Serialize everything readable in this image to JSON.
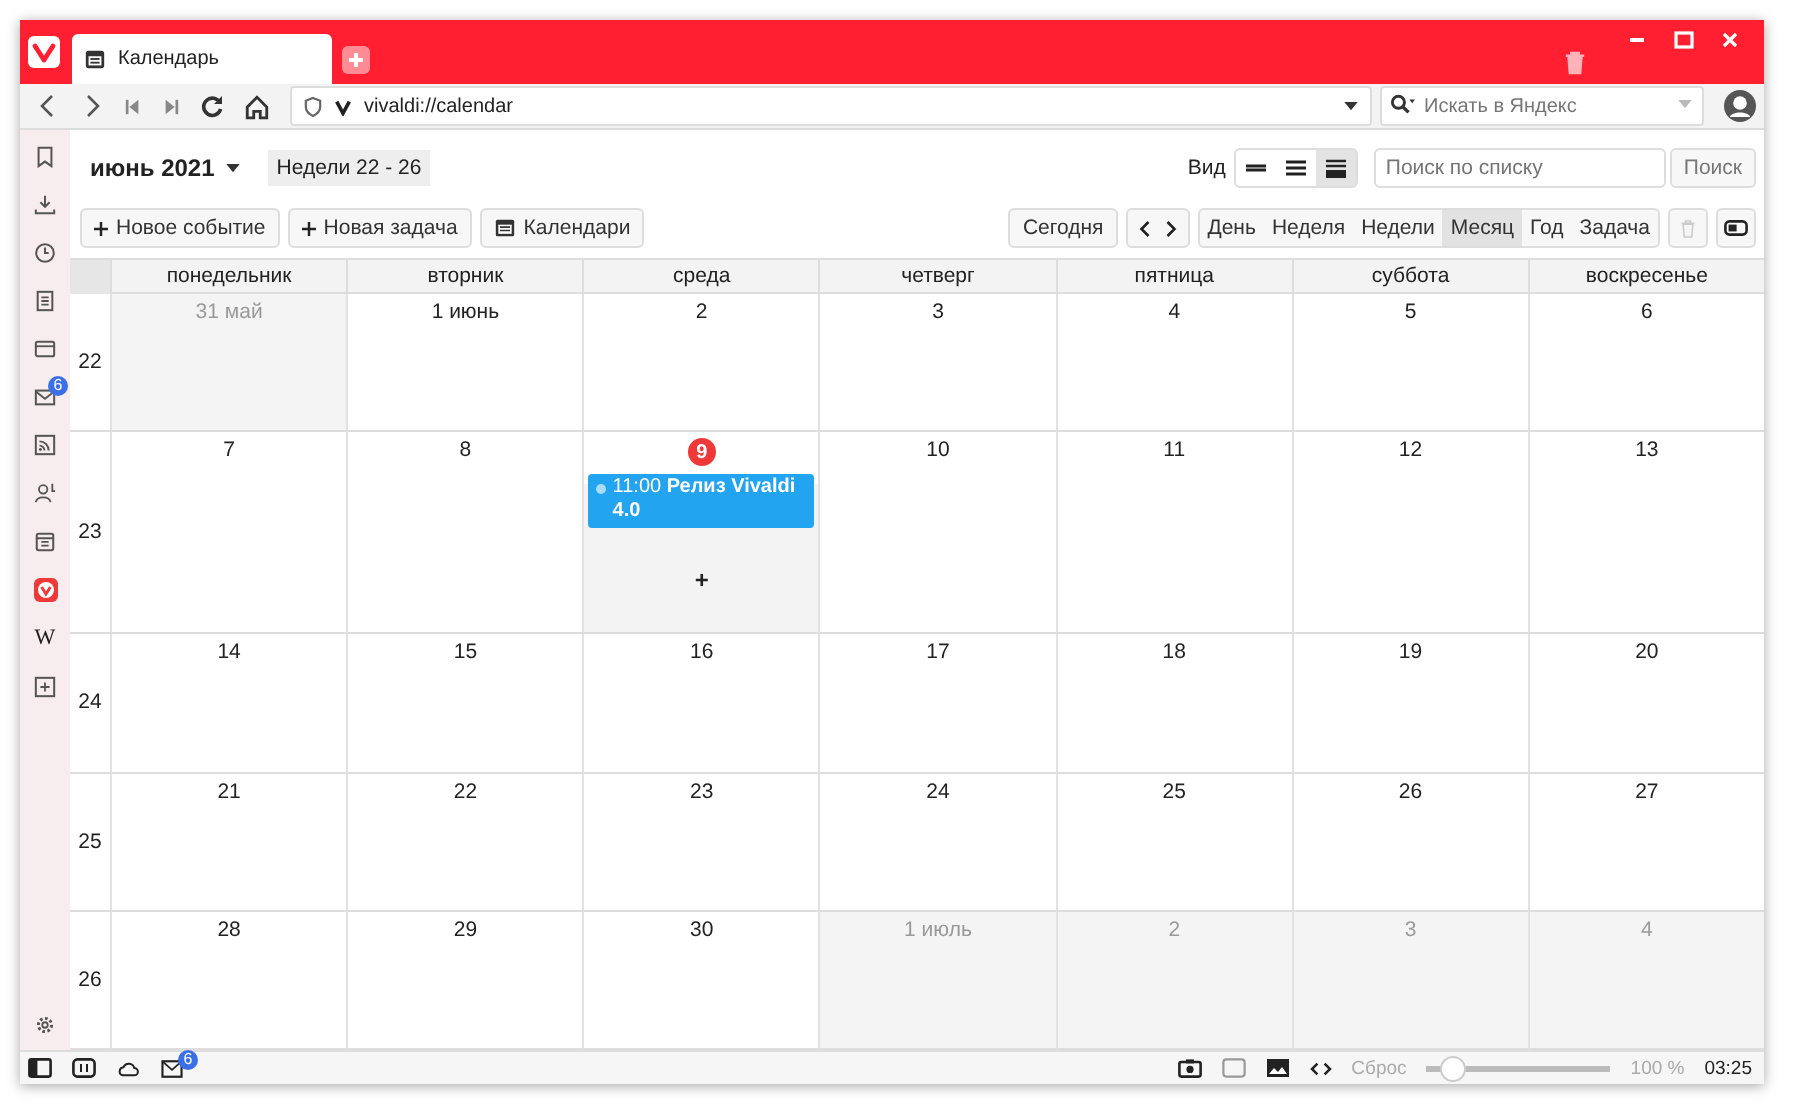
{
  "tab": {
    "title": "Календарь"
  },
  "address": {
    "url": "vivaldi://calendar",
    "search_placeholder": "Искать в Яндекс"
  },
  "sidebar": {
    "mail_badge": "6",
    "web_panel": "W"
  },
  "toolbar": {
    "period": "июнь 2021",
    "weeks": "Недели 22 - 26",
    "view_label": "Вид",
    "view_modes": [
      {
        "selected": false
      },
      {
        "selected": false
      },
      {
        "selected": true
      }
    ],
    "list_search_placeholder": "Поиск по списку",
    "search_button": "Поиск",
    "actions": [
      {
        "kind": "plus",
        "label": "Новое событие"
      },
      {
        "kind": "plus",
        "label": "Новая задача"
      },
      {
        "kind": "calendar",
        "label": "Календари"
      }
    ],
    "today_button": "Сегодня",
    "ranges": [
      {
        "label": "День",
        "selected": false
      },
      {
        "label": "Неделя",
        "selected": false
      },
      {
        "label": "Недели",
        "selected": false
      },
      {
        "label": "Месяц",
        "selected": true
      },
      {
        "label": "Год",
        "selected": false
      },
      {
        "label": "Задача",
        "selected": false
      }
    ]
  },
  "calendar": {
    "weekdays": [
      "понедельник",
      "вторник",
      "среда",
      "четверг",
      "пятница",
      "суббота",
      "воскресенье"
    ],
    "weeks": [
      {
        "number": "22",
        "days": [
          {
            "date": "31 май",
            "in_month": false
          },
          {
            "date": "1 июнь",
            "in_month": true
          },
          {
            "date": "2",
            "in_month": true
          },
          {
            "date": "3",
            "in_month": true
          },
          {
            "date": "4",
            "in_month": true
          },
          {
            "date": "5",
            "in_month": true
          },
          {
            "date": "6",
            "in_month": true
          }
        ]
      },
      {
        "number": "23",
        "days": [
          {
            "date": "7",
            "in_month": true
          },
          {
            "date": "8",
            "in_month": true
          },
          {
            "date": "9",
            "in_month": true,
            "today": true,
            "add_mark": "+",
            "events": [
              {
                "text": "11:00 **Релиз Vivaldi 4.0**"
              }
            ]
          },
          {
            "date": "10",
            "in_month": true
          },
          {
            "date": "11",
            "in_month": true
          },
          {
            "date": "12",
            "in_month": true
          },
          {
            "date": "13",
            "in_month": true
          }
        ]
      },
      {
        "number": "24",
        "days": [
          {
            "date": "14",
            "in_month": true
          },
          {
            "date": "15",
            "in_month": true
          },
          {
            "date": "16",
            "in_month": true
          },
          {
            "date": "17",
            "in_month": true
          },
          {
            "date": "18",
            "in_month": true
          },
          {
            "date": "19",
            "in_month": true
          },
          {
            "date": "20",
            "in_month": true
          }
        ]
      },
      {
        "number": "25",
        "days": [
          {
            "date": "21",
            "in_month": true
          },
          {
            "date": "22",
            "in_month": true
          },
          {
            "date": "23",
            "in_month": true
          },
          {
            "date": "24",
            "in_month": true
          },
          {
            "date": "25",
            "in_month": true
          },
          {
            "date": "26",
            "in_month": true
          },
          {
            "date": "27",
            "in_month": true
          }
        ]
      },
      {
        "number": "26",
        "days": [
          {
            "date": "28",
            "in_month": true
          },
          {
            "date": "29",
            "in_month": true
          },
          {
            "date": "30",
            "in_month": true
          },
          {
            "date": "1 июль",
            "in_month": false
          },
          {
            "date": "2",
            "in_month": false
          },
          {
            "date": "3",
            "in_month": false
          },
          {
            "date": "4",
            "in_month": false
          }
        ]
      }
    ]
  },
  "status_bar": {
    "mail_badge": "6",
    "reset": "Сброс",
    "zoom": {
      "level": 0.15
    },
    "zoom_text": "100 %",
    "clock": "03:25"
  }
}
